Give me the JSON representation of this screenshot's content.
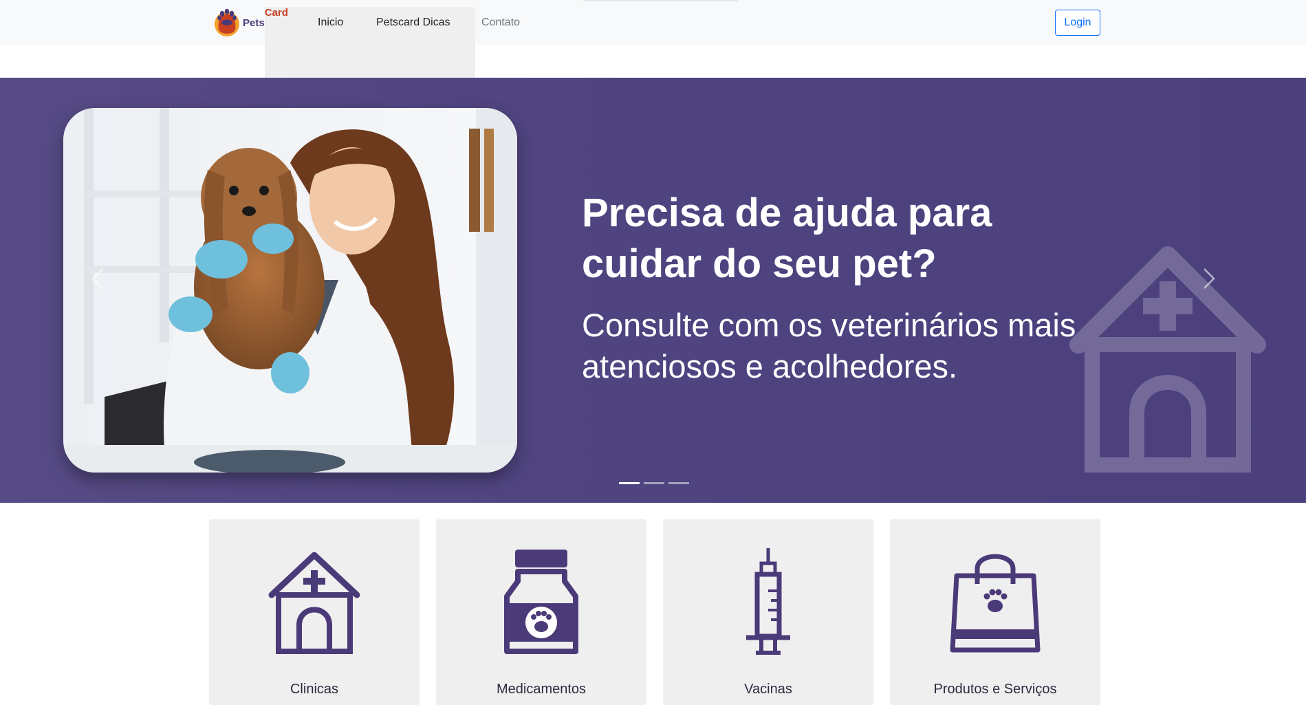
{
  "navbar": {
    "brand": {
      "part1": "Pets",
      "part2": "Card"
    },
    "links": [
      {
        "label": "Inicio"
      },
      {
        "label": "Petscard Dicas"
      },
      {
        "label": "Contato"
      }
    ],
    "login_label": "Login"
  },
  "hero": {
    "title": "Precisa de ajuda para cuidar do seu pet?",
    "subtitle": "Consulte com os veterinários mais atenciosos e acolhedores.",
    "active_slide": 1,
    "slide_count": 3,
    "background_color": "#4f4380"
  },
  "services": [
    {
      "label": "Clinicas",
      "icon": "clinic-house-icon"
    },
    {
      "label": "Medicamentos",
      "icon": "medicine-bottle-icon"
    },
    {
      "label": "Vacinas",
      "icon": "syringe-icon"
    },
    {
      "label": "Produtos e Serviços",
      "icon": "pet-shopping-bag-icon"
    }
  ],
  "colors": {
    "accent": "#4b3a78",
    "brand_secondary": "#c8401f",
    "login_border": "#0d6efd"
  }
}
